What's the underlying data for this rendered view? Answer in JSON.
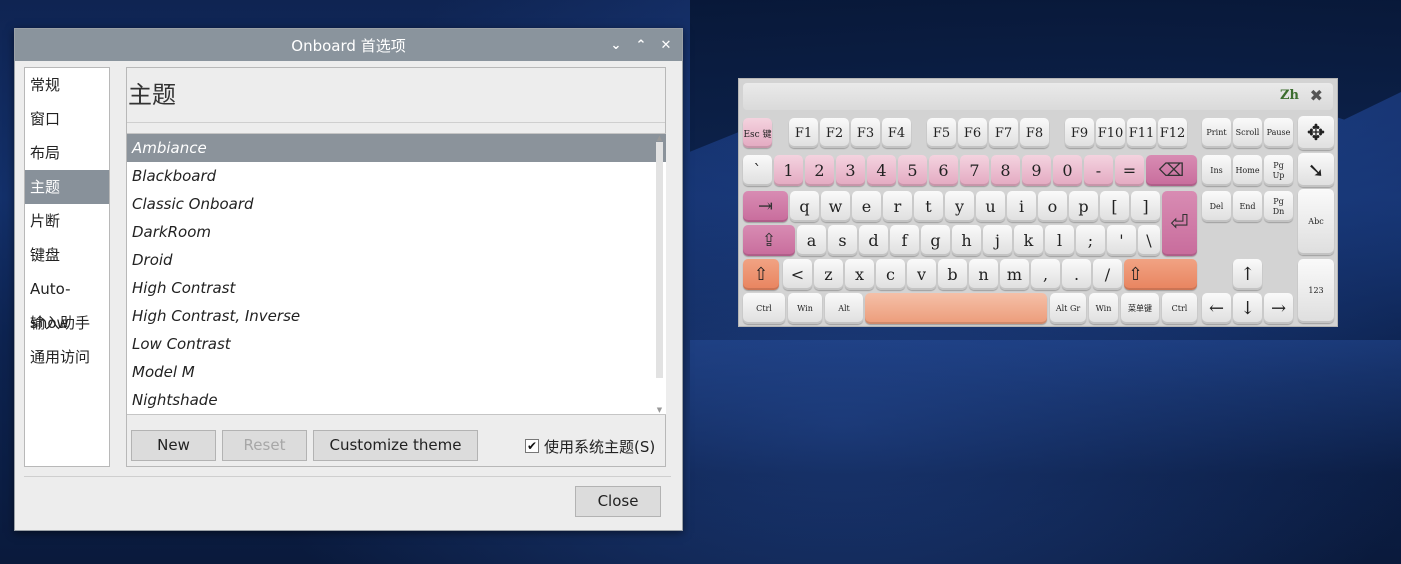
{
  "dialog": {
    "title": "Onboard 首选项",
    "controls": [
      "⌄",
      "⌃",
      "✕"
    ],
    "sidebar": [
      "常规",
      "窗口",
      "布局",
      "主题",
      "片断",
      "键盘",
      "Auto-show",
      "输入助手",
      "通用访问"
    ],
    "sidebar_active_index": 3,
    "section_title": "主题",
    "themes": [
      "Ambiance",
      "Blackboard",
      "Classic Onboard",
      "DarkRoom",
      "Droid",
      "High Contrast",
      "High Contrast, Inverse",
      "Low Contrast",
      "Model M",
      "Nightshade"
    ],
    "selected_theme_index": 0,
    "buttons": {
      "new": "New",
      "reset": "Reset",
      "customize": "Customize theme",
      "close": "Close"
    },
    "use_system_theme": {
      "label": "使用系统主题(S)",
      "checked": true,
      "mark": "✔"
    }
  },
  "keyboard": {
    "lang": "Zh",
    "close": "✖",
    "keys": {
      "esc": "Esc 键",
      "fkeys": [
        "F1",
        "F2",
        "F3",
        "F4",
        "F5",
        "F6",
        "F7",
        "F8",
        "F9",
        "F10",
        "F11",
        "F12"
      ],
      "print": "Print",
      "scroll": "Scroll",
      "pause": "Pause",
      "move": "✥",
      "number_row": [
        "`",
        "1",
        "2",
        "3",
        "4",
        "5",
        "6",
        "7",
        "8",
        "9",
        "0",
        "-",
        "="
      ],
      "backspace": "⌫",
      "ins": "Ins",
      "home": "Home",
      "pgup": "Pg Up",
      "pointer": "➘",
      "tab": "⇥",
      "qwerty_row": [
        "q",
        "w",
        "e",
        "r",
        "t",
        "y",
        "u",
        "i",
        "o",
        "p",
        "[",
        "]"
      ],
      "enter": "⏎",
      "del": "Del",
      "end": "End",
      "pgdn": "Pg Dn",
      "abc": "Abc",
      "caps": "⇪",
      "home_row": [
        "a",
        "s",
        "d",
        "f",
        "g",
        "h",
        "j",
        "k",
        "l",
        ";",
        "'",
        "\\"
      ],
      "shift": "⇧",
      "bottom_letter_row": [
        "<",
        "z",
        "x",
        "c",
        "v",
        "b",
        "n",
        "m",
        ",",
        ".",
        "/"
      ],
      "shift_right": "⇧",
      "up": "↑",
      "num": "123",
      "ctrl": "Ctrl",
      "win": "Win",
      "alt": "Alt",
      "altgr": "Alt Gr",
      "win_right": "Win",
      "menu": "菜单键",
      "ctrl_right": "Ctrl",
      "left": "←",
      "down": "↓",
      "right": "→"
    }
  }
}
